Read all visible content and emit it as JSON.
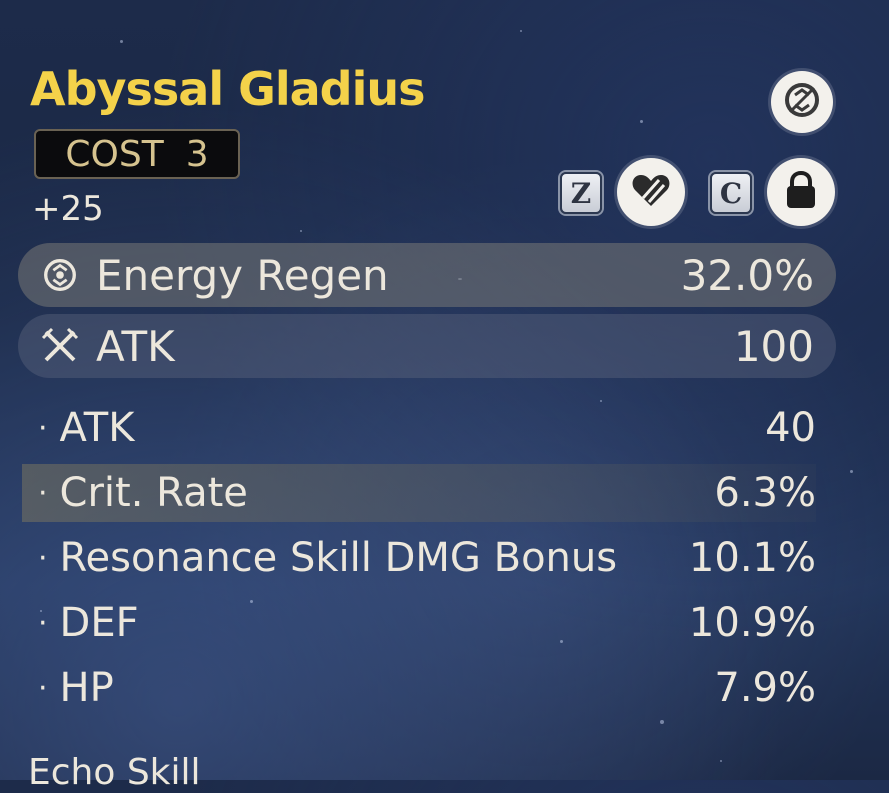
{
  "echo": {
    "name": "Abyssal Gladius",
    "cost_label": "COST",
    "cost_value": "3",
    "level": "+25"
  },
  "controls": {
    "top_icon": "energy-regen-icon",
    "discard_key": "Z",
    "discard_icon": "broken-heart-icon",
    "lock_key": "C",
    "lock_icon": "lock-icon"
  },
  "main_stats": [
    {
      "icon": "energy-regen-icon",
      "name": "Energy Regen",
      "value": "32.0%"
    },
    {
      "icon": "atk-swords-icon",
      "name": "ATK",
      "value": "100"
    }
  ],
  "sub_stats": [
    {
      "name": "ATK",
      "value": "40",
      "highlighted": false
    },
    {
      "name": "Crit. Rate",
      "value": "6.3%",
      "highlighted": true
    },
    {
      "name": "Resonance Skill DMG Bonus",
      "value": "10.1%",
      "highlighted": false
    },
    {
      "name": "DEF",
      "value": "10.9%",
      "highlighted": false
    },
    {
      "name": "HP",
      "value": "7.9%",
      "highlighted": false
    }
  ],
  "footer": {
    "section_title": "Echo Skill"
  },
  "colors": {
    "title": "#f4d24a",
    "text": "#ece7dc",
    "background": "#1d2b4a"
  }
}
